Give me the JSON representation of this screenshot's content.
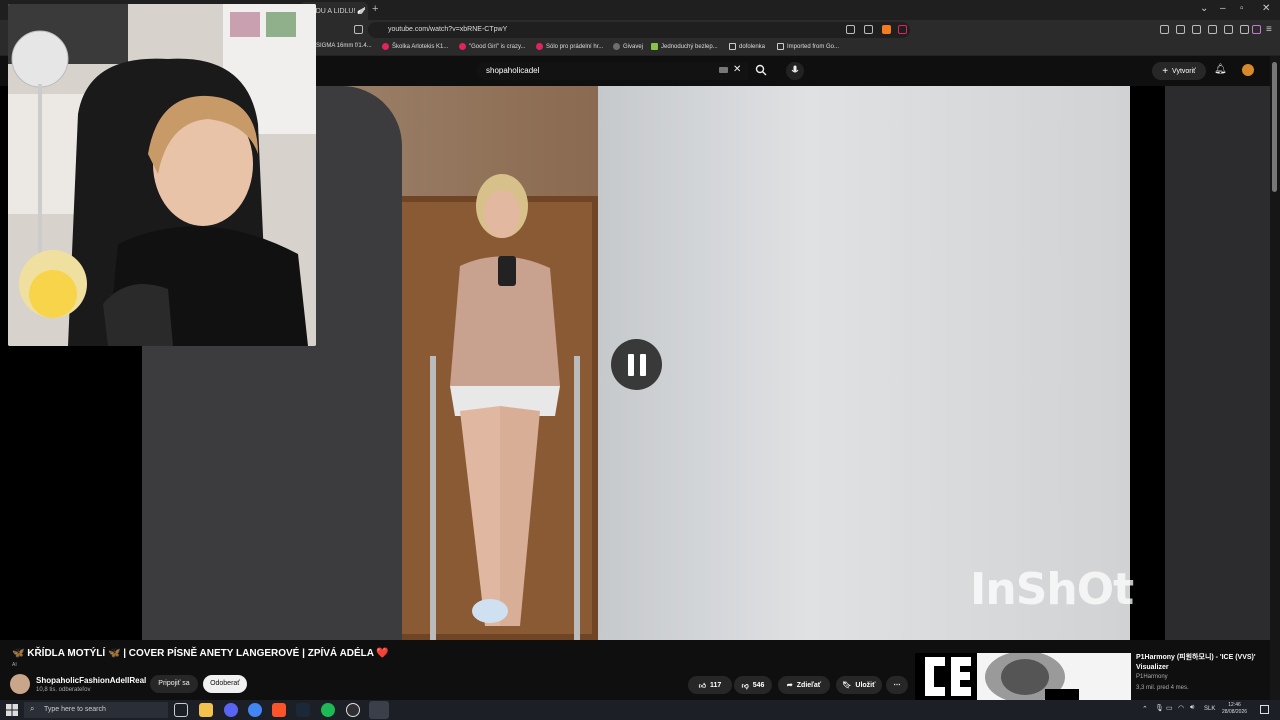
{
  "browser": {
    "tab_title": "ANDU A LIDLU! 🪽",
    "url": "youtube.com/watch?v=xbRNE-CTpwY",
    "bookmarks": [
      {
        "label": "SIGMA 16mm f/1.4...",
        "color": "#444444"
      },
      {
        "label": "Školka Arlotekis K1...",
        "color": "#e0245e"
      },
      {
        "label": "\"Good Girl\" is crazy...",
        "color": "#e0245e"
      },
      {
        "label": "Sólo pro prádelní hr...",
        "color": "#e0245e"
      },
      {
        "label": "Givavej",
        "color": "#6e6e6e"
      },
      {
        "label": "Jednoduchý bezlep...",
        "color": "#8bc34a"
      },
      {
        "label": "dofolenka",
        "color": "#cccccc"
      },
      {
        "label": "Imported from Go...",
        "color": "#cccccc"
      }
    ]
  },
  "youtube": {
    "search_value": "shopaholicadel",
    "create_label": "Vytvoriť",
    "video": {
      "title": "🦋 KŘÍDLA MOTÝLÍ 🦋 | COVER PÍSNĚ ANETY LANGEROVÉ | ZPÍVÁ ADÉLA ❤️",
      "ai_label": "AI",
      "watermark": "InShOt",
      "state": "paused"
    },
    "channel": {
      "name": "ShopaholicFashionAdellReal",
      "subscribers": "10,8 tis. odberateľov",
      "join_label": "Pripojiť sa",
      "unsubscribe_label": "Odoberať"
    },
    "actions": {
      "likes": "117",
      "dislikes": "546",
      "share_label": "Zdieľať",
      "save_label": "Uložiť"
    },
    "recommended": {
      "title": "P1Harmony (피원하모니) - 'ICE (VVS)' Visualizer",
      "channel": "P1Harmony",
      "meta": "3,3 mil.   pred 4 mes."
    }
  },
  "taskbar": {
    "search_placeholder": "Type here to search",
    "language": "SLK",
    "time": "12:46",
    "date": "28/08/2026"
  },
  "colors": {
    "youtube_bg": "#0f0f0f",
    "accent_red": "#e0245e",
    "button_bg": "#272727"
  }
}
